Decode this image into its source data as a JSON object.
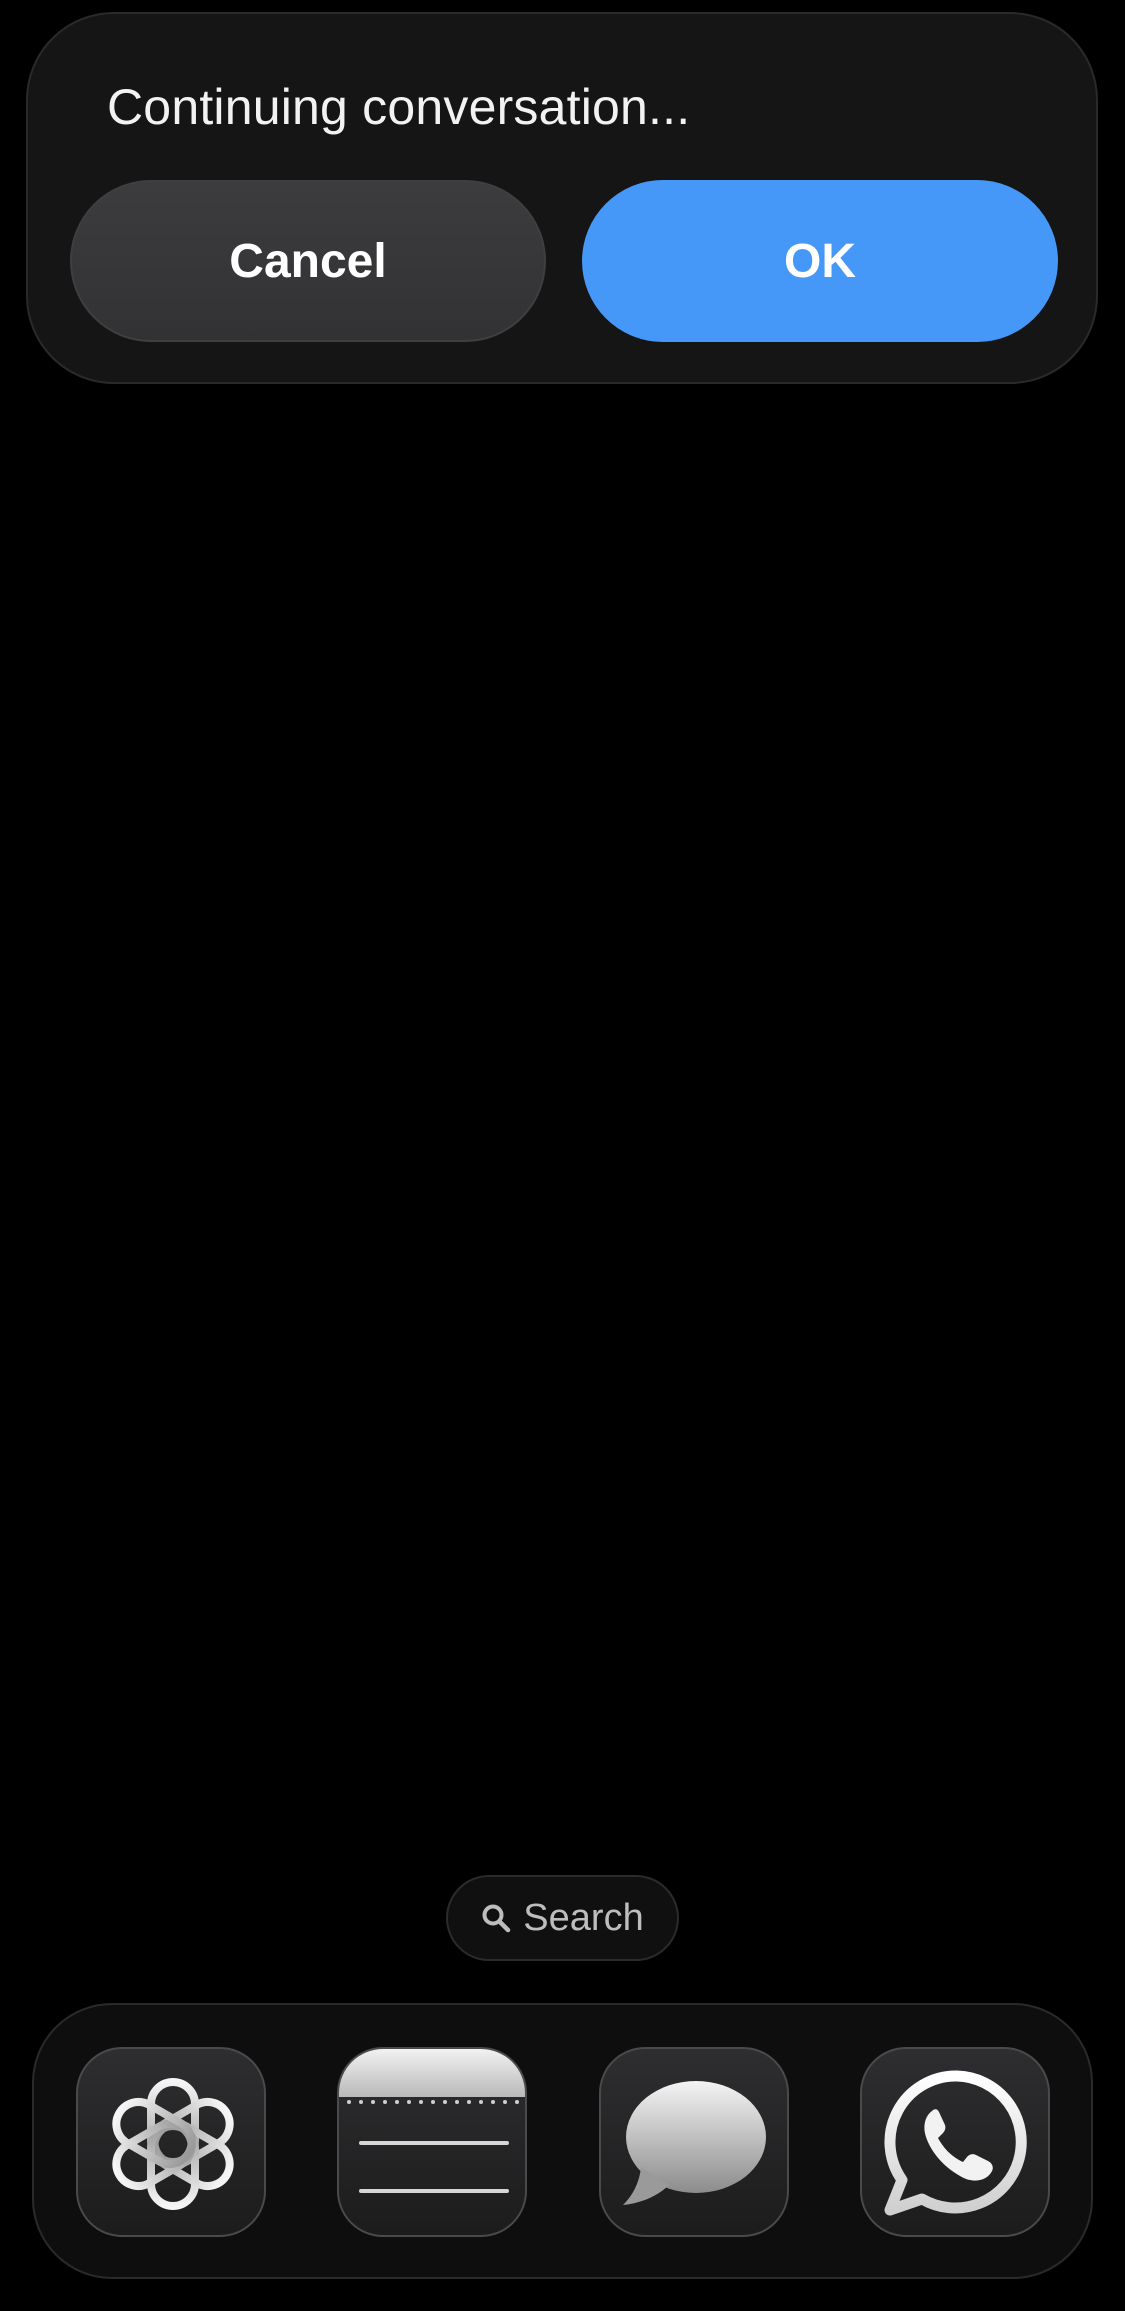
{
  "alert": {
    "title": "Continuing conversation...",
    "cancel_label": "Cancel",
    "ok_label": "OK"
  },
  "search": {
    "label": "Search",
    "icon": "magnifying-glass-icon"
  },
  "dock": {
    "apps": [
      {
        "name": "ChatGPT",
        "icon": "openai-logo-icon"
      },
      {
        "name": "Notes",
        "icon": "notes-icon"
      },
      {
        "name": "Messages",
        "icon": "speech-bubble-icon"
      },
      {
        "name": "WhatsApp",
        "icon": "whatsapp-phone-icon"
      }
    ]
  },
  "colors": {
    "background": "#000000",
    "alert_bg": "#151516",
    "ok_button": "#4698f8",
    "cancel_button": "#3a3a3c"
  }
}
